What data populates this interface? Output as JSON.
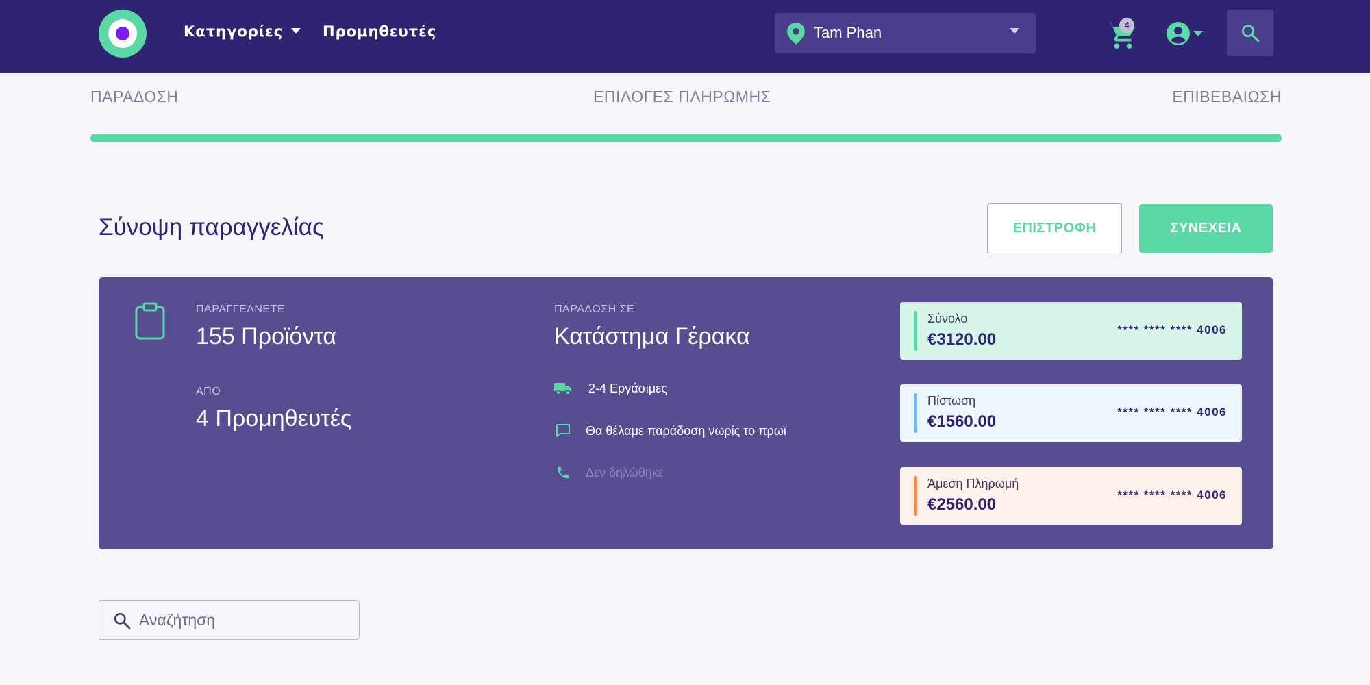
{
  "nav": {
    "categories_label": "Κατηγορίες",
    "suppliers_label": "Προμηθευτές",
    "location": "Tam Phan",
    "cart_count": "4",
    "icons": [
      "logo",
      "caret-down-icon",
      "map-pin-icon",
      "cart-icon",
      "account-circle-icon",
      "search-icon"
    ]
  },
  "stepper": {
    "steps": [
      "ΠΑΡΑΔΟΣΗ",
      "ΕΠΙΛΟΓΕΣ ΠΛΗΡΩΜΗΣ",
      "ΕΠΙΒΕΒΑΙΩΣΗ"
    ],
    "progress_percent": 100
  },
  "page": {
    "title": "Σύνοψη παραγγελίας",
    "back_label": "ΕΠΙΣΤΡΟΦΗ",
    "next_label": "ΣΥΝΕΧΕΙΑ"
  },
  "summary": {
    "ordering_label": "ΠΑΡΑΓΓΕΛΝΕΤΕ",
    "products": "155 Προϊόντα",
    "from_label": "ΑΠΟ",
    "suppliers": "4 Προμηθευτές",
    "delivery_label": "ΠΑΡΑΔΟΣΗ ΣΕ",
    "store": "Κατάστημα Γέρακα",
    "days": "2-4 Εργάσιμες",
    "note": "Θα θέλαμε παράδοση νωρίς το πρωϊ",
    "phone": "Δεν δηλώθηκε"
  },
  "payments": [
    {
      "name": "Σύνολο",
      "amount": "€3120.00",
      "card": "**** **** **** 4006",
      "color": "#5ad8a6"
    },
    {
      "name": "Πίστωση",
      "amount": "€1560.00",
      "card": "**** **** **** 4006",
      "color": "#7cb7f2"
    },
    {
      "name": "Άμεση Πληρωμή",
      "amount": "€2560.00",
      "card": "**** **** **** 4006",
      "color": "#f08a4b"
    }
  ],
  "search": {
    "placeholder": "Αναζήτηση"
  },
  "colors": {
    "nav_bg": "#2e2471",
    "accent": "#5ad8a6",
    "card_bg": "#574d91"
  }
}
